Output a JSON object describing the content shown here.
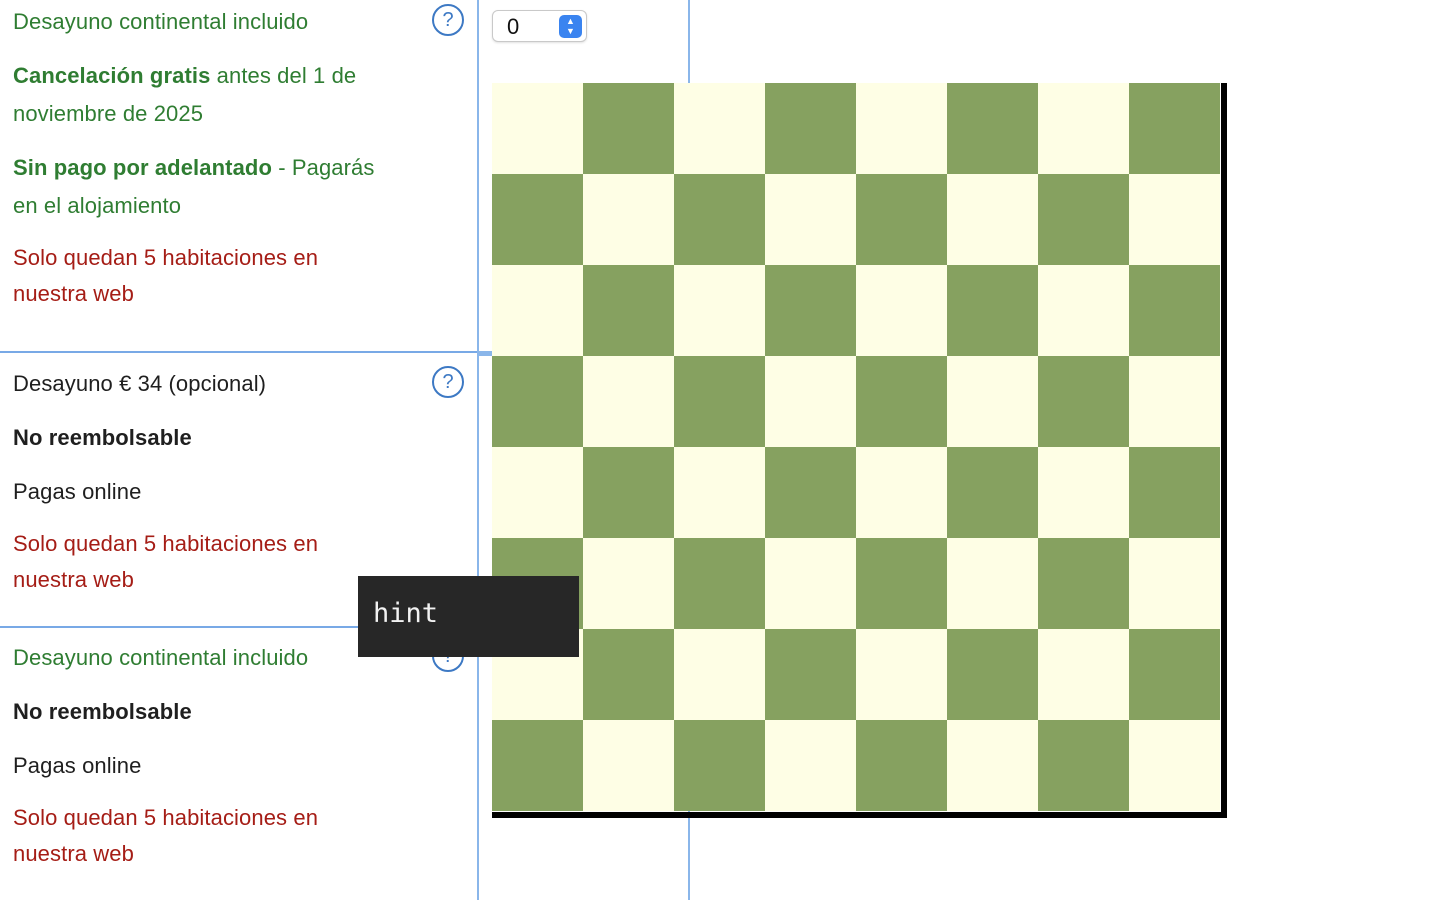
{
  "offers": [
    {
      "lines": [
        {
          "parts": [
            {
              "text": "Desayuno continental incluido",
              "style": "green"
            }
          ]
        },
        {
          "parts": [
            {
              "text": "Cancelación gratis",
              "style": "green bold"
            },
            {
              "text": " antes del 1 de",
              "style": "green"
            }
          ]
        },
        {
          "parts": [
            {
              "text": "noviembre de 2025",
              "style": "green"
            }
          ]
        },
        {
          "parts": [
            {
              "text": "Sin pago por adelantado",
              "style": "green bold"
            },
            {
              "text": " - Pagarás",
              "style": "green"
            }
          ]
        },
        {
          "parts": [
            {
              "text": "en el alojamiento",
              "style": "green"
            }
          ]
        },
        {
          "parts": [
            {
              "text": "Solo quedan 5 habitaciones en",
              "style": "red"
            }
          ]
        },
        {
          "parts": [
            {
              "text": "nuestra web",
              "style": "red"
            }
          ]
        }
      ],
      "help_icon": "question-circle-icon",
      "help_glyph": "?"
    },
    {
      "lines": [
        {
          "parts": [
            {
              "text": "Desayuno € 34 (opcional)",
              "style": "dark"
            }
          ]
        },
        {
          "parts": [
            {
              "text": "No reembolsable",
              "style": "dark bold"
            }
          ]
        },
        {
          "parts": [
            {
              "text": "Pagas online",
              "style": "dark"
            }
          ]
        },
        {
          "parts": [
            {
              "text": "Solo quedan 5 habitaciones en",
              "style": "red"
            }
          ]
        },
        {
          "parts": [
            {
              "text": "nuestra web",
              "style": "red"
            }
          ]
        }
      ],
      "help_icon": "question-circle-icon",
      "help_glyph": "?"
    },
    {
      "lines": [
        {
          "parts": [
            {
              "text": "Desayuno continental incluido",
              "style": "green"
            }
          ]
        },
        {
          "parts": [
            {
              "text": "No reembolsable",
              "style": "dark bold"
            }
          ]
        },
        {
          "parts": [
            {
              "text": "Pagas online",
              "style": "dark"
            }
          ]
        },
        {
          "parts": [
            {
              "text": "Solo quedan 5 habitaciones en",
              "style": "red"
            }
          ]
        },
        {
          "parts": [
            {
              "text": "nuestra web",
              "style": "red"
            }
          ]
        }
      ],
      "help_icon": "question-circle-icon",
      "help_glyph": "?"
    }
  ],
  "stepper": {
    "value": "0",
    "arrows_icon": "up-down-chevron-icon",
    "arrows_glyph": "▲\n▼"
  },
  "board": {
    "rows": 8,
    "cols": 8,
    "light_color": "#fefee5",
    "dark_color": "#86a160",
    "top_left": "light"
  },
  "tooltip": {
    "text": "hint"
  },
  "colors": {
    "green_text": "#2f7d32",
    "red_text": "#a51d16",
    "divider": "#78a9e6",
    "help_icon": "#3d79c4",
    "stepper_accent": "#3a84f0"
  }
}
